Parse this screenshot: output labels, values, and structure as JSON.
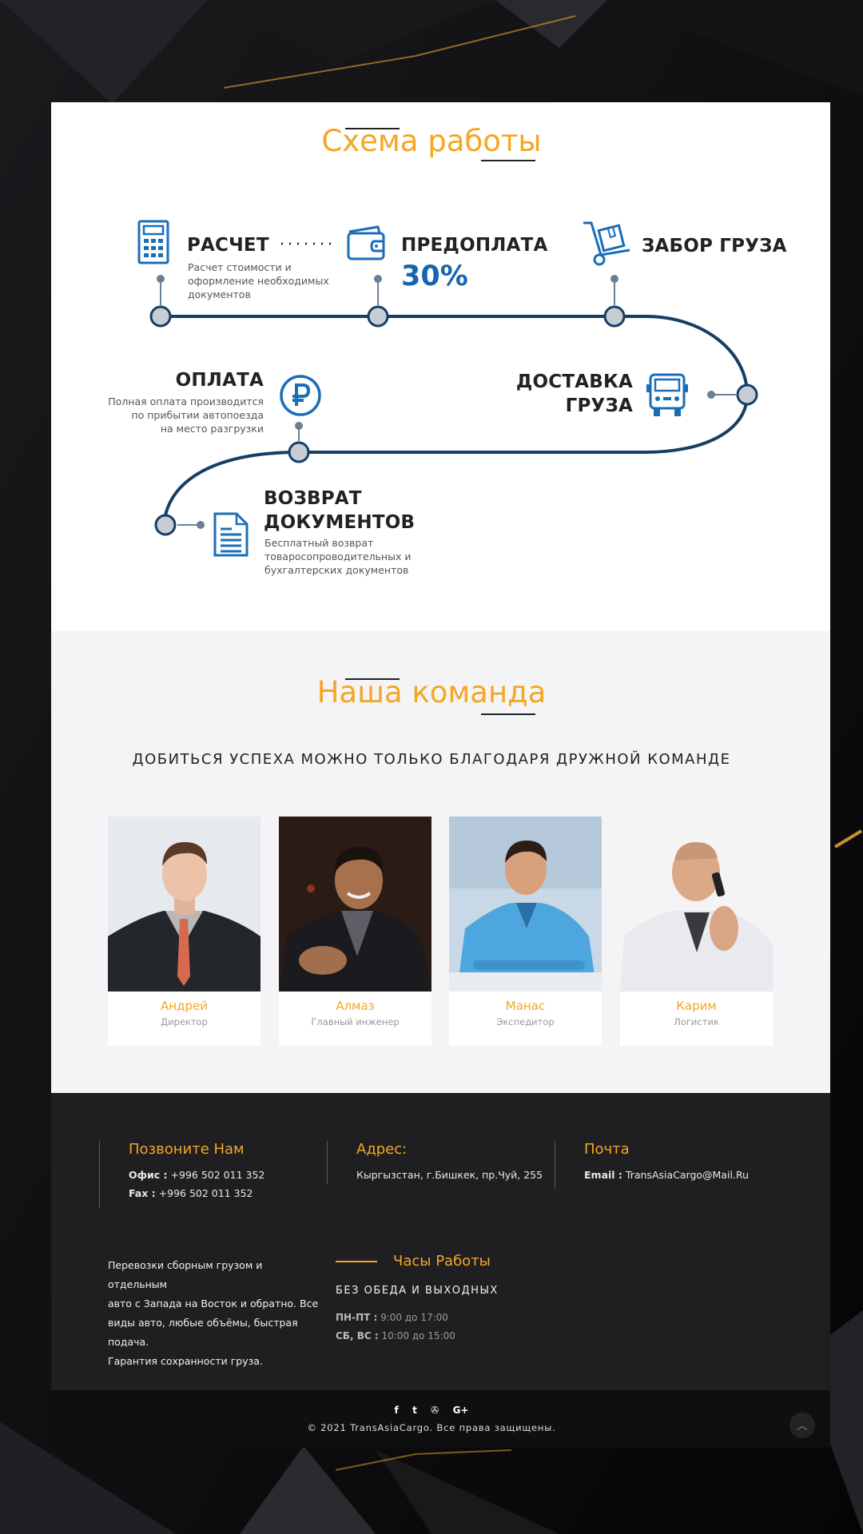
{
  "scheme": {
    "title": "Схема работы",
    "steps": [
      {
        "title": "РАСЧЕТ",
        "desc": [
          "Расчет стоимости и",
          "оформление необходимых",
          "документов"
        ]
      },
      {
        "title": "ПРЕДОПЛАТА",
        "value": "30%"
      },
      {
        "title": "ЗАБОР ГРУЗА"
      },
      {
        "title": [
          "ДОСТАВКА",
          "ГРУЗА"
        ]
      },
      {
        "title": "ОПЛАТА",
        "desc": [
          "Полная оплата производится",
          "по прибытии автопоезда",
          "на место разгрузки"
        ]
      },
      {
        "title": [
          "ВОЗВРАТ",
          "ДОКУМЕНТОВ"
        ],
        "desc": [
          "Бесплатный возврат",
          "товаросопроводительных и",
          "бухгалтерских документов"
        ]
      }
    ]
  },
  "team": {
    "title": "Наша команда",
    "subtitle": "ДОБИТЬСЯ УСПЕХА МОЖНО ТОЛЬКО БЛАГОДАРЯ ДРУЖНОЙ КОМАНДЕ",
    "members": [
      {
        "name": "Андрей",
        "role": "Директор"
      },
      {
        "name": "Алмаз",
        "role": "Главный инженер"
      },
      {
        "name": "Манас",
        "role": "Экспедитор"
      },
      {
        "name": "Карим",
        "role": "Логистик"
      }
    ]
  },
  "footer": {
    "call": {
      "title": "Позвоните Нам",
      "office_label": "Офис :",
      "office": "+996 502 011 352",
      "fax_label": "Fax :",
      "fax": "+996 502 011 352"
    },
    "address": {
      "title": "Адрес:",
      "value": "Кыргызстан, г.Бишкек, пр.Чуй, 255"
    },
    "mail": {
      "title": "Почта",
      "label": "Email :",
      "value": "TransAsiaCargo@Mail.Ru"
    },
    "about": [
      "Перевозки сборным грузом и отдельным",
      "авто с Запада на Восток и обратно. Все",
      "виды авто, любые объёмы, быстрая подача.",
      "Гарантия сохранности груза."
    ],
    "hours": {
      "title": "Часы Работы",
      "subtitle": "БЕЗ ОБЕДА И ВЫХОДНЫХ",
      "weekdays_label": "ПН-ПТ :",
      "weekdays": "9:00 до 17:00",
      "weekend_label": "СБ, ВС :",
      "weekend": "10:00 до 15:00"
    },
    "social": [
      "f",
      "t",
      "✇",
      "G+"
    ],
    "copyright": "© 2021 TransAsiaCargo. Все права защищены."
  },
  "colors": {
    "accent": "#f5a623",
    "path": "#153e66",
    "icon": "#1a6eb8",
    "footer_bg": "#1f1f22"
  },
  "icons": [
    "calculator-icon",
    "wallet-icon",
    "hand-truck-icon",
    "truck-icon",
    "ruble-icon",
    "document-icon",
    "facebook-icon",
    "twitter-icon",
    "dribbble-icon",
    "google-plus-icon",
    "arrow-up-icon"
  ]
}
